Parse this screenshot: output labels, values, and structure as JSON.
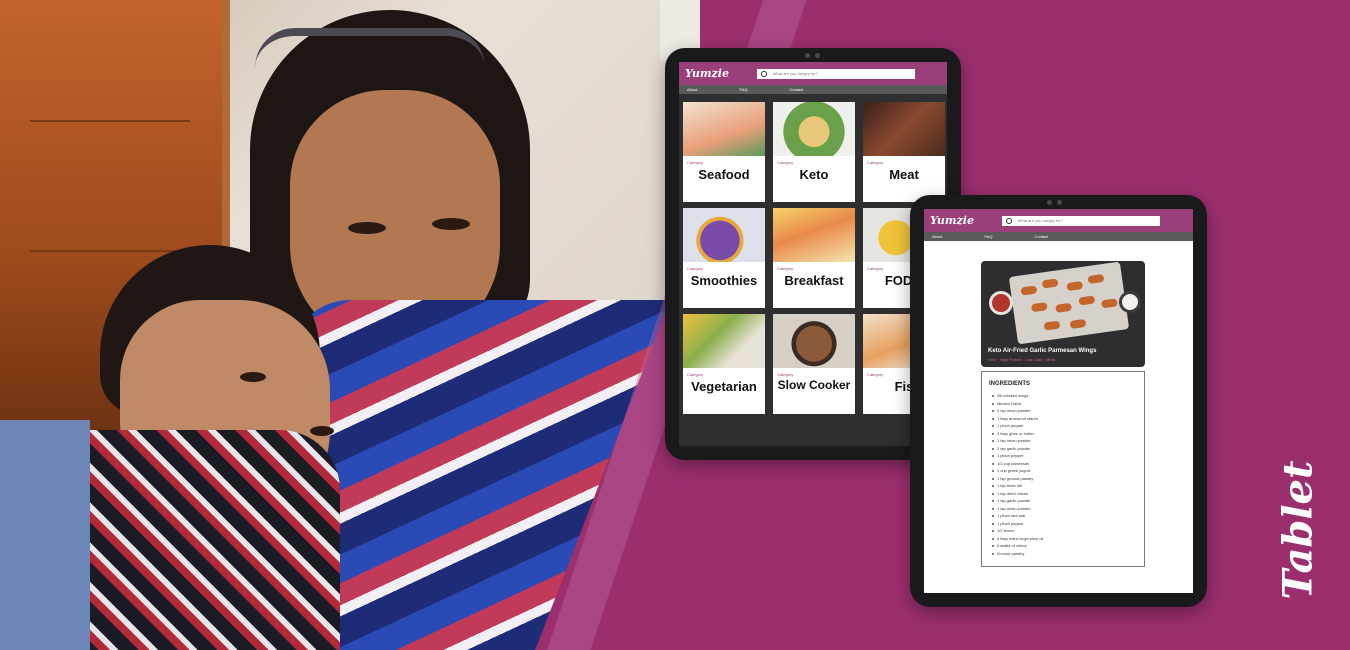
{
  "side_label": "Tablet",
  "app": {
    "logo": "Yumzie",
    "search_placeholder": "What are you hungry for?",
    "nav": [
      "About",
      "FAQ",
      "Contact"
    ]
  },
  "categories": [
    {
      "label": "Category",
      "name": "Seafood",
      "img": "#e9b79a"
    },
    {
      "label": "Category",
      "name": "Keto",
      "img": "#8fb16a"
    },
    {
      "label": "Category",
      "name": "Meat",
      "img": "#6e3a26"
    },
    {
      "label": "Category",
      "name": "Smoothies",
      "img": "#5a4a9a"
    },
    {
      "label": "Category",
      "name": "Breakfast",
      "img": "#f0b84a"
    },
    {
      "label": "Category",
      "name": "FODM",
      "img": "#e7c24a"
    },
    {
      "label": "Category",
      "name": "Vegetarian",
      "img": "#b98a4a"
    },
    {
      "label": "Category",
      "name": "Slow Cooker",
      "img": "#7c5236"
    },
    {
      "label": "Category",
      "name": "Fis",
      "img": "#e8b46a"
    }
  ],
  "recipe": {
    "title": "Keto Air-Fried Garlic Parmesan Wings",
    "tags": "Keto · High Protein · Low Carb · Meat",
    "ingredients_heading": "INGREDIENTS",
    "ingredients": [
      "2lb chicken wings",
      "Minced Garlic",
      "2 tsp onion powder",
      "1 tbsp arrowroot starch",
      "1 pinch pepper",
      "3 tbsp ghee or butter",
      "1 tsp onion powder",
      "2 tsp garlic powder",
      "1 pinch pepper",
      "1/2 cup parmesan",
      "1 cup greek yogurt",
      "1 tsp ground parsley",
      "1 tsp fresh dill",
      "1 tsp dried chives",
      "1 tsp garlic powder",
      "1 tsp onion powder",
      "1 pinch sea salt",
      "1 pinch pepper",
      "1/2 lemon",
      "4 tbsp extra-virgin olive oil",
      "6 stalks of celery",
      "Ground parsley"
    ]
  }
}
